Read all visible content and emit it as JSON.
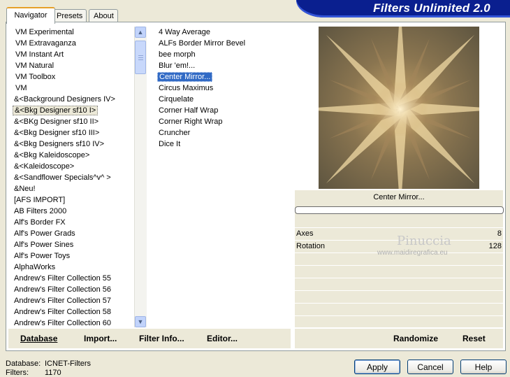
{
  "app": {
    "title": "Filters Unlimited 2.0"
  },
  "tabs": [
    {
      "label": "Navigator",
      "active": true
    },
    {
      "label": "Presets",
      "active": false
    },
    {
      "label": "About",
      "active": false
    }
  ],
  "categories": {
    "selected_index": 7,
    "items": [
      "VM Experimental",
      "VM Extravaganza",
      "VM Instant Art",
      "VM Natural",
      "VM Toolbox",
      "VM",
      "&<Background Designers IV>",
      "&<Bkg Designer sf10 I>",
      "&<BKg Designer sf10 II>",
      "&<Bkg Designer sf10 III>",
      "&<Bkg Designers sf10 IV>",
      "&<Bkg Kaleidoscope>",
      "&<Kaleidoscope>",
      "&<Sandflower Specials^v^ >",
      "&Neu!",
      "[AFS IMPORT]",
      "AB Filters 2000",
      "Alf's Border FX",
      "Alf's Power Grads",
      "Alf's Power Sines",
      "Alf's Power Toys",
      "AlphaWorks",
      "Andrew's Filter Collection 55",
      "Andrew's Filter Collection 56",
      "Andrew's Filter Collection 57",
      "Andrew's Filter Collection 58",
      "Andrew's Filter Collection 60"
    ]
  },
  "filters": {
    "selected_index": 4,
    "items": [
      "4 Way Average",
      "ALFs Border Mirror Bevel",
      "bee morph",
      "Blur 'em!...",
      "Center Mirror...",
      "Circus Maximus",
      "Cirquelate",
      "Corner Half Wrap",
      "Corner Right Wrap",
      "Cruncher",
      "Dice It"
    ]
  },
  "preview": {
    "filter_name": "Center Mirror...",
    "progress_percent": 0
  },
  "params": [
    {
      "label": "Axes",
      "value": "8"
    },
    {
      "label": "Rotation",
      "value": "128"
    }
  ],
  "watermark": {
    "name": "Pinuccia",
    "url": "www.maidiregrafica.eu"
  },
  "toolbar": {
    "database_label": "Database",
    "import_label": "Import...",
    "filter_info_label": "Filter Info...",
    "editor_label": "Editor...",
    "randomize_label": "Randomize",
    "reset_label": "Reset"
  },
  "status": {
    "database_key": "Database:",
    "database_value": "ICNET-Filters",
    "filters_key": "Filters:",
    "filters_value": "1170"
  },
  "buttons": {
    "apply": "Apply",
    "cancel": "Cancel",
    "help": "Help"
  }
}
